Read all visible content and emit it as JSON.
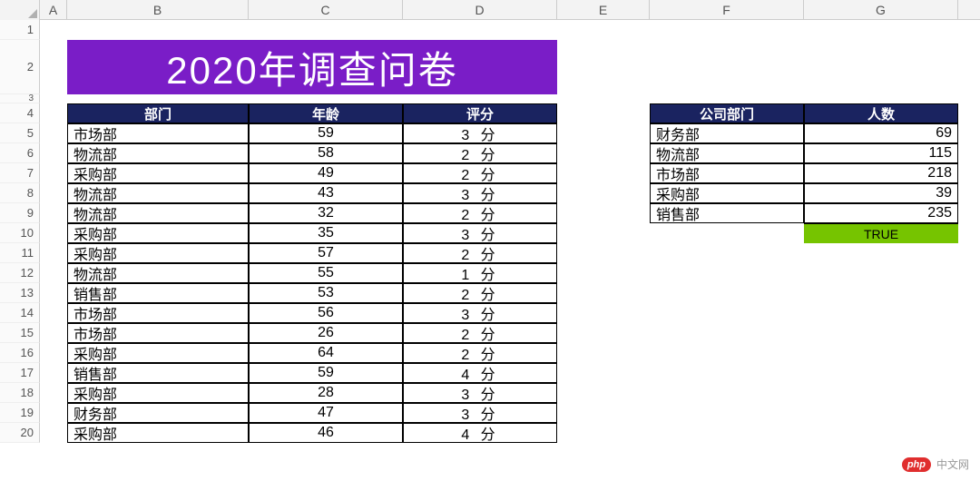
{
  "columns": [
    "A",
    "B",
    "C",
    "D",
    "E",
    "F",
    "G"
  ],
  "row_numbers": [
    1,
    2,
    3,
    4,
    5,
    6,
    7,
    8,
    9,
    10,
    11,
    12,
    13,
    14,
    15,
    16,
    17,
    18,
    19,
    20
  ],
  "title": "2020年调查问卷",
  "main_headers": {
    "dept": "部门",
    "age": "年龄",
    "score": "评分"
  },
  "main_rows": [
    {
      "dept": "市场部",
      "age": 59,
      "score": "3 分"
    },
    {
      "dept": "物流部",
      "age": 58,
      "score": "2 分"
    },
    {
      "dept": "采购部",
      "age": 49,
      "score": "2 分"
    },
    {
      "dept": "物流部",
      "age": 43,
      "score": "3 分"
    },
    {
      "dept": "物流部",
      "age": 32,
      "score": "2 分"
    },
    {
      "dept": "采购部",
      "age": 35,
      "score": "3 分"
    },
    {
      "dept": "采购部",
      "age": 57,
      "score": "2 分"
    },
    {
      "dept": "物流部",
      "age": 55,
      "score": "1 分"
    },
    {
      "dept": "销售部",
      "age": 53,
      "score": "2 分"
    },
    {
      "dept": "市场部",
      "age": 56,
      "score": "3 分"
    },
    {
      "dept": "市场部",
      "age": 26,
      "score": "2 分"
    },
    {
      "dept": "采购部",
      "age": 64,
      "score": "2 分"
    },
    {
      "dept": "销售部",
      "age": 59,
      "score": "4 分"
    },
    {
      "dept": "采购部",
      "age": 28,
      "score": "3 分"
    },
    {
      "dept": "财务部",
      "age": 47,
      "score": "3 分"
    },
    {
      "dept": "采购部",
      "age": 46,
      "score": "4 分"
    }
  ],
  "side_headers": {
    "dept": "公司部门",
    "count": "人数"
  },
  "side_rows": [
    {
      "dept": "财务部",
      "count": 69
    },
    {
      "dept": "物流部",
      "count": 115
    },
    {
      "dept": "市场部",
      "count": 218
    },
    {
      "dept": "采购部",
      "count": 39
    },
    {
      "dept": "销售部",
      "count": 235
    }
  ],
  "true_cell": "TRUE",
  "watermark": {
    "badge": "php",
    "text": "中文网"
  },
  "chart_data": {
    "type": "table",
    "title": "2020年调查问卷",
    "series": [
      {
        "name": "部门/年龄/评分",
        "columns": [
          "部门",
          "年龄",
          "评分"
        ],
        "rows": [
          [
            "市场部",
            59,
            "3 分"
          ],
          [
            "物流部",
            58,
            "2 分"
          ],
          [
            "采购部",
            49,
            "2 分"
          ],
          [
            "物流部",
            43,
            "3 分"
          ],
          [
            "物流部",
            32,
            "2 分"
          ],
          [
            "采购部",
            35,
            "3 分"
          ],
          [
            "采购部",
            57,
            "2 分"
          ],
          [
            "物流部",
            55,
            "1 分"
          ],
          [
            "销售部",
            53,
            "2 分"
          ],
          [
            "市场部",
            56,
            "3 分"
          ],
          [
            "市场部",
            26,
            "2 分"
          ],
          [
            "采购部",
            64,
            "2 分"
          ],
          [
            "销售部",
            59,
            "4 分"
          ],
          [
            "采购部",
            28,
            "3 分"
          ],
          [
            "财务部",
            47,
            "3 分"
          ],
          [
            "采购部",
            46,
            "4 分"
          ]
        ]
      },
      {
        "name": "公司部门/人数",
        "columns": [
          "公司部门",
          "人数"
        ],
        "rows": [
          [
            "财务部",
            69
          ],
          [
            "物流部",
            115
          ],
          [
            "市场部",
            218
          ],
          [
            "采购部",
            39
          ],
          [
            "销售部",
            235
          ]
        ]
      }
    ]
  }
}
